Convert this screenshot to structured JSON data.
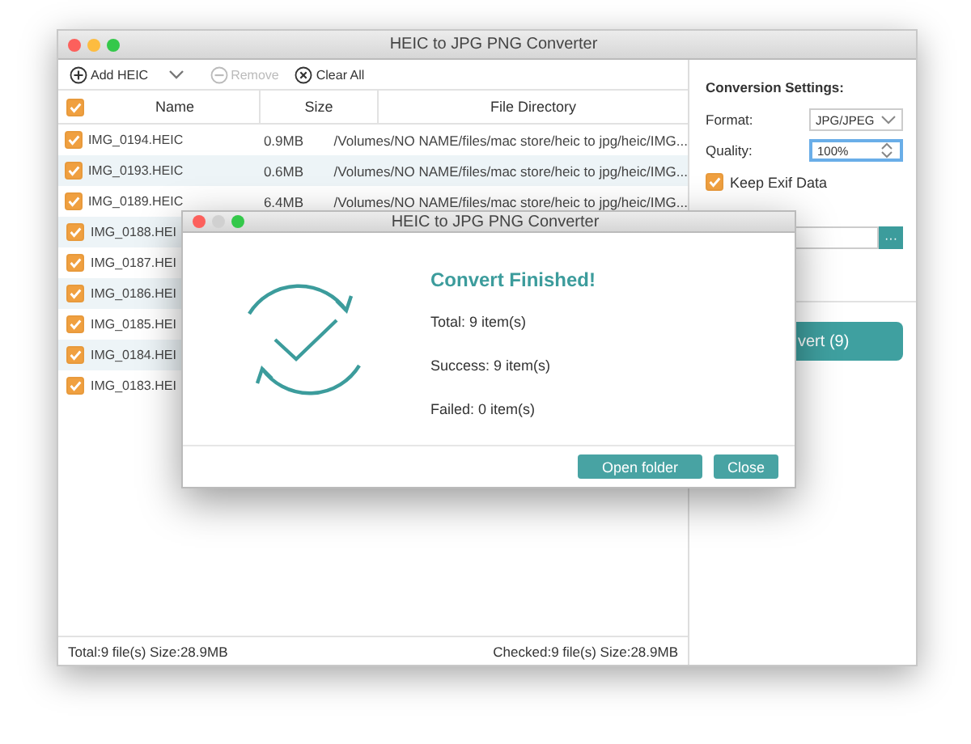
{
  "window": {
    "title": "HEIC to JPG PNG Converter"
  },
  "toolbar": [
    {
      "kind": "add",
      "label": "Add HEIC",
      "disabled": false
    },
    {
      "kind": "remove",
      "label": "Remove",
      "disabled": true
    },
    {
      "kind": "clear",
      "label": "Clear All",
      "disabled": false
    }
  ],
  "table": {
    "all_checked": true,
    "columns": [
      "Name",
      "Size",
      "File Directory"
    ],
    "rows": [
      {
        "checked": true,
        "name": "IMG_0194.HEIC",
        "size": "0.9MB",
        "directory": "/Volumes/NO NAME/files/mac store/heic to jpg/heic/IMG..."
      },
      {
        "checked": true,
        "name": "IMG_0193.HEIC",
        "size": "0.6MB",
        "directory": "/Volumes/NO NAME/files/mac store/heic to jpg/heic/IMG..."
      },
      {
        "checked": true,
        "name": "IMG_0189.HEIC",
        "size": "6.4MB",
        "directory": "/Volumes/NO NAME/files/mac store/heic to jpg/heic/IMG..."
      },
      {
        "checked": true,
        "name": "IMG_0188.HEI"
      },
      {
        "checked": true,
        "name": "IMG_0187.HEI"
      },
      {
        "checked": true,
        "name": "IMG_0186.HEI"
      },
      {
        "checked": true,
        "name": "IMG_0185.HEI"
      },
      {
        "checked": true,
        "name": "IMG_0184.HEI"
      },
      {
        "checked": true,
        "name": "IMG_0183.HEI"
      }
    ]
  },
  "settings": {
    "heading": "Conversion Settings:",
    "format_label": "Format:",
    "format": "JPG/JPEG",
    "quality_label": "Quality:",
    "quality": "100%",
    "keep_exif": {
      "label": "Keep Exif Data",
      "checked": true
    },
    "browse_button": "···",
    "convert_button": "vert (9)"
  },
  "status_bar": {
    "total": "Total:9 file(s) Size:28.9MB",
    "checked": "Checked:9 file(s) Size:28.9MB"
  },
  "dialog": {
    "title": "HEIC to JPG PNG Converter",
    "heading": "Convert Finished!",
    "lines": [
      "Total: 9 item(s)",
      "Success: 9 item(s)",
      "Failed: 0 item(s)"
    ],
    "buttons": [
      "Open folder",
      "Close"
    ]
  }
}
